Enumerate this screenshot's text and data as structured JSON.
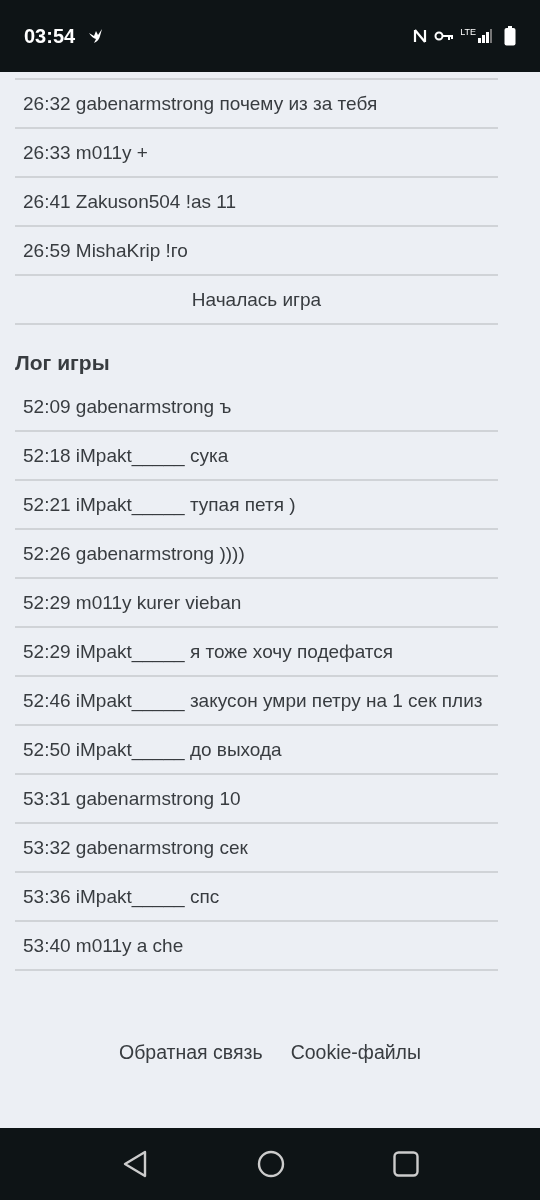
{
  "status_bar": {
    "time": "03:54",
    "network": "LTE"
  },
  "chat": [
    {
      "kind": "message",
      "text": "26:32 gabenarmstrong почему из за тебя"
    },
    {
      "kind": "message",
      "text": "26:33 m011y +"
    },
    {
      "kind": "message",
      "text": "26:41 Zakuson504 !as 11"
    },
    {
      "kind": "message",
      "text": "26:59 MishaKrip !го"
    },
    {
      "kind": "event",
      "text": "Началась игра"
    }
  ],
  "game_log": {
    "title": "Лог игры",
    "entries": [
      {
        "text": "52:09 gabenarmstrong ъ"
      },
      {
        "text": "52:18 iMpakt_____ сука"
      },
      {
        "text": "52:21 iMpakt_____ тупая петя )"
      },
      {
        "text": "52:26 gabenarmstrong ))))"
      },
      {
        "text": "52:29 m011y kurer vieban"
      },
      {
        "text": "52:29 iMpakt_____ я тоже хочу подефатся"
      },
      {
        "text": "52:46 iMpakt_____ закусон умри петру на 1 сек плиз"
      },
      {
        "text": "52:50 iMpakt_____ до выхода"
      },
      {
        "text": "53:31 gabenarmstrong 10"
      },
      {
        "text": "53:32 gabenarmstrong сек"
      },
      {
        "text": "53:36 iMpakt_____ спс"
      },
      {
        "text": "53:40 m011y a che"
      }
    ]
  },
  "footer_links": [
    "Обратная связь",
    "Cookie-файлы"
  ]
}
